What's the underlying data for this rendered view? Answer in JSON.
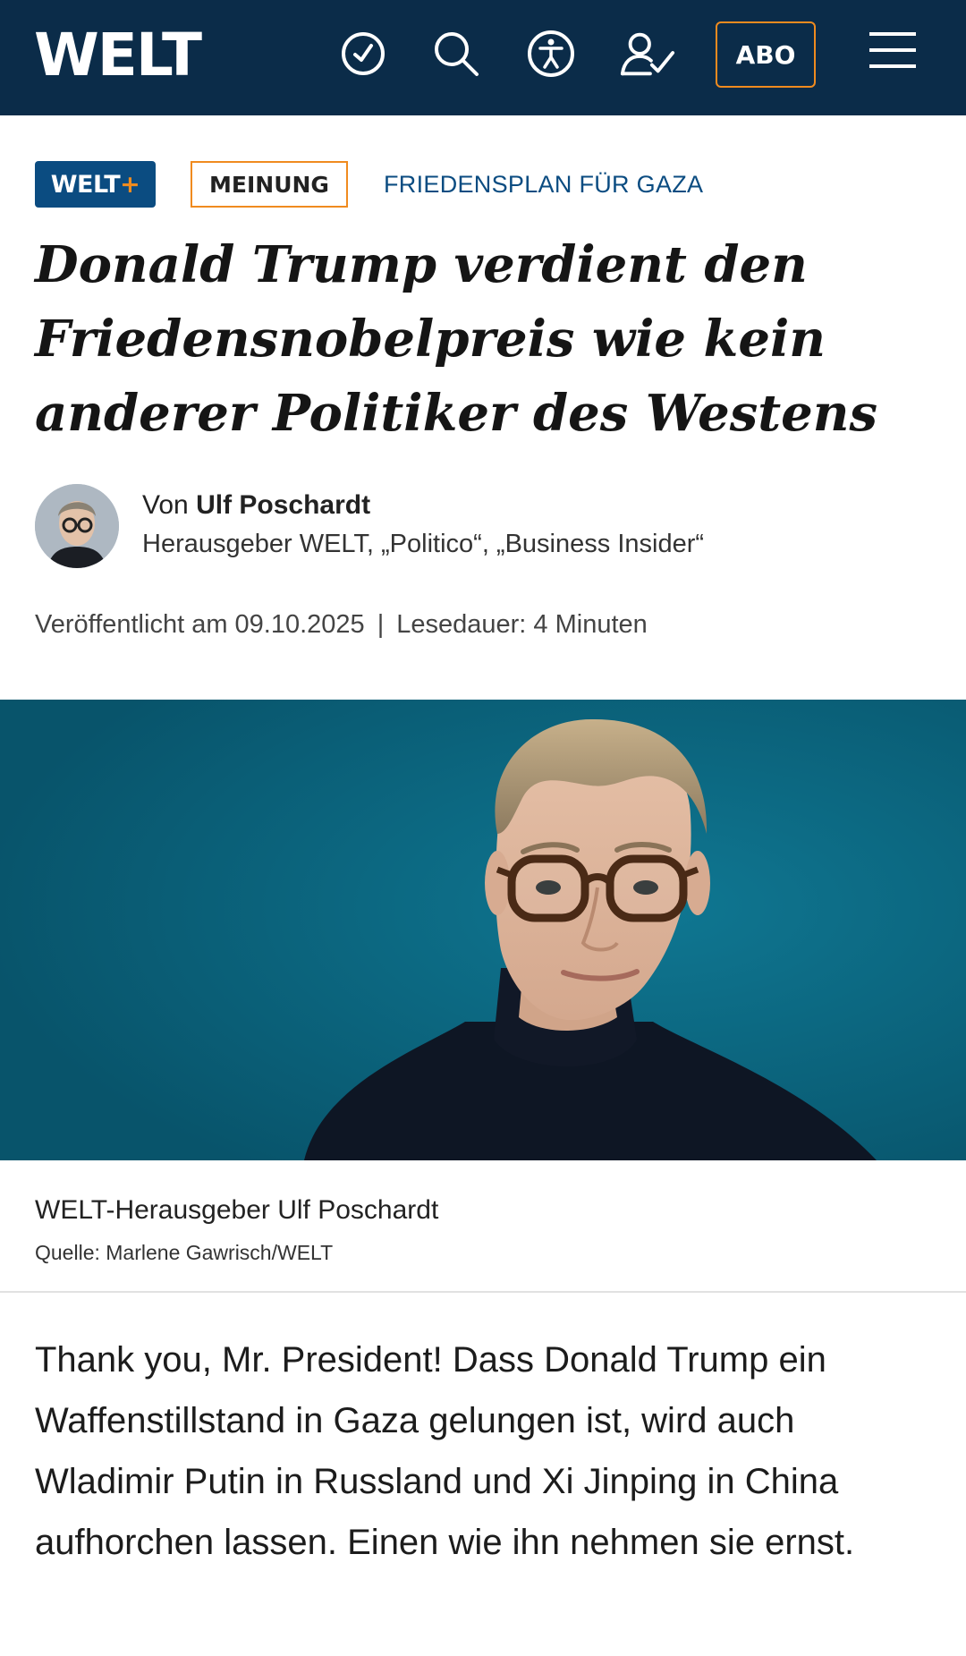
{
  "header": {
    "logo": "WELT",
    "icons": [
      "clock-icon",
      "search-icon",
      "accessibility-icon",
      "user-check-icon",
      "menu-icon"
    ],
    "abo_label": "ABO"
  },
  "tags": {
    "welt_plus": "WELT",
    "welt_plus_suffix": "+",
    "meinung": "MEINUNG",
    "topic": "FRIEDENSPLAN FÜR GAZA"
  },
  "article": {
    "headline": "Donald Trump verdient den Friedensnobelpreis wie kein anderer Politiker des Westens",
    "author_prefix": "Von",
    "author_name": "Ulf Poschardt",
    "author_role": "Herausgeber WELT, „Politico“, „Business Insider“",
    "published": "Veröffentlicht am 09.10.2025",
    "separator": "|",
    "read_time": "Lesedauer: 4 Minuten",
    "image_caption": "WELT-Herausgeber Ulf Poschardt",
    "image_source": "Quelle: Marlene Gawrisch/WELT",
    "lead": "Thank you, Mr. President! Dass Donald Trump ein Waffenstillstand in Gaza gelungen ist, wird auch Wladimir Putin in Russland und Xi Jinping in China aufhorchen lassen. Einen wie ihn nehmen sie ernst."
  },
  "colors": {
    "header_bg": "#0b2c49",
    "accent_orange": "#f08b1f",
    "brand_blue": "#0b4c81",
    "hero_bg": "#0a5f78"
  }
}
